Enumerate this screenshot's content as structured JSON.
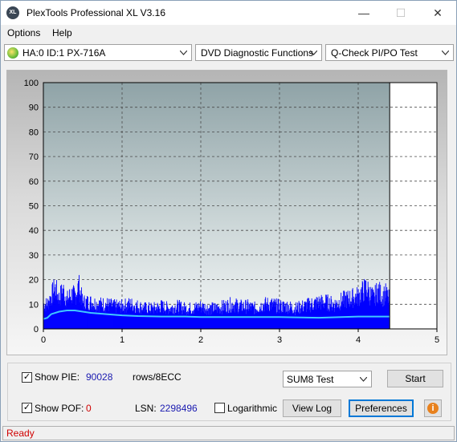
{
  "window": {
    "title": "PlexTools Professional XL V3.16",
    "icon_text": "XL",
    "controls": {
      "minimize": "—",
      "maximize": "☐",
      "close": "✕"
    }
  },
  "menu": {
    "options": "Options",
    "help": "Help"
  },
  "toolbar": {
    "drive": "HA:0 ID:1  PX-716A",
    "function": "DVD Diagnostic Functions",
    "test": "Q-Check PI/PO Test"
  },
  "chart_data": {
    "type": "area",
    "xlabel": "",
    "ylabel": "",
    "xlim": [
      0,
      5
    ],
    "ylim": [
      0,
      100
    ],
    "x_ticks": [
      "0",
      "1",
      "2",
      "3",
      "4",
      "5"
    ],
    "y_ticks": [
      "0",
      "10",
      "20",
      "30",
      "40",
      "50",
      "60",
      "70",
      "80",
      "90",
      "100"
    ],
    "grid": true,
    "data_end_x": 4.4,
    "marker_x": 4.4,
    "series": [
      {
        "kind": "pie-bars",
        "color": "#0000ff",
        "x": [
          0.05,
          0.1,
          0.15,
          0.2,
          0.25,
          0.3,
          0.35,
          0.4,
          0.45,
          0.5,
          0.6,
          0.7,
          0.8,
          0.9,
          1.0,
          1.1,
          1.2,
          1.3,
          1.4,
          1.5,
          1.6,
          1.7,
          1.8,
          1.9,
          2.0,
          2.1,
          2.2,
          2.3,
          2.4,
          2.5,
          2.6,
          2.7,
          2.8,
          2.9,
          3.0,
          3.1,
          3.2,
          3.3,
          3.4,
          3.5,
          3.6,
          3.7,
          3.8,
          3.9,
          4.0,
          4.05,
          4.1,
          4.15,
          4.2,
          4.25,
          4.3,
          4.35,
          4.4
        ],
        "values": [
          12,
          16,
          20,
          15,
          19,
          14,
          17,
          16,
          21,
          13,
          13,
          12,
          12,
          11,
          11,
          12,
          11,
          10,
          10,
          11,
          10,
          11,
          10,
          10,
          11,
          10,
          10,
          11,
          12,
          11,
          11,
          10,
          12,
          12,
          11,
          11,
          10,
          11,
          12,
          13,
          13,
          12,
          14,
          15,
          16,
          18,
          20,
          17,
          15,
          19,
          16,
          17,
          14
        ]
      },
      {
        "kind": "sum8-line",
        "color": "#40c8ff",
        "x": [
          0.0,
          0.05,
          0.1,
          0.2,
          0.3,
          0.4,
          0.5,
          0.6,
          0.8,
          1.0,
          1.2,
          1.5,
          1.8,
          2.0,
          2.5,
          3.0,
          3.5,
          4.0,
          4.4
        ],
        "values": [
          4,
          4.5,
          6,
          7,
          7.5,
          7.5,
          7,
          6.5,
          6,
          5.5,
          5.2,
          5,
          5,
          4.8,
          4.8,
          4.8,
          4.5,
          5,
          5
        ]
      }
    ]
  },
  "controls": {
    "show_pie_label": "Show PIE:",
    "pie_value": "90028",
    "rows_label": "rows/8ECC",
    "show_pof_label": "Show POF:",
    "pof_value": "0",
    "lsn_label": "LSN:",
    "lsn_value": "2298496",
    "logarithmic_label": "Logarithmic",
    "sum8_select": "SUM8 Test",
    "start_button": "Start",
    "view_log_button": "View Log",
    "preferences_button": "Preferences",
    "info_glyph": "i",
    "show_pie_checked": "✓",
    "show_pof_checked": "✓"
  },
  "status": {
    "text": "Ready"
  }
}
